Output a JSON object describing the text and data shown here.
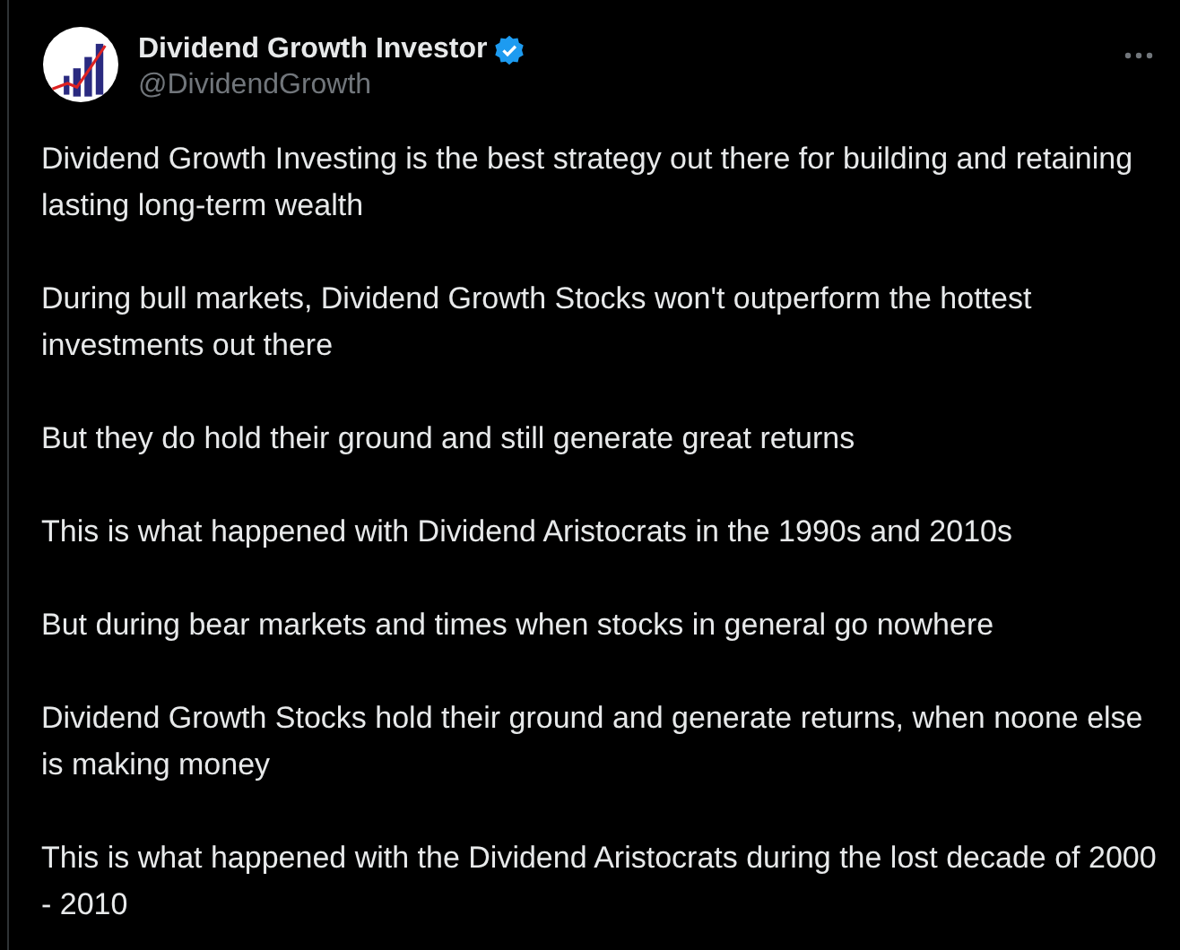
{
  "post": {
    "author": {
      "name": "Dividend Growth Investor",
      "verified": true,
      "handle": "@DividendGrowth"
    },
    "paragraphs": [
      "Dividend Growth Investing is the best strategy out there for building and retaining lasting long-term wealth",
      "During bull markets, Dividend Growth Stocks won't outperform the hottest investments out there",
      "But they do hold their ground and still generate great returns",
      "This is what happened with Dividend Aristocrats in the 1990s and 2010s",
      "But during bear markets and times when stocks in general go nowhere",
      "Dividend Growth Stocks hold their ground and generate returns, when noone else is making money",
      "This is what happened with the Dividend Aristocrats during the lost decade of 2000 - 2010"
    ]
  }
}
